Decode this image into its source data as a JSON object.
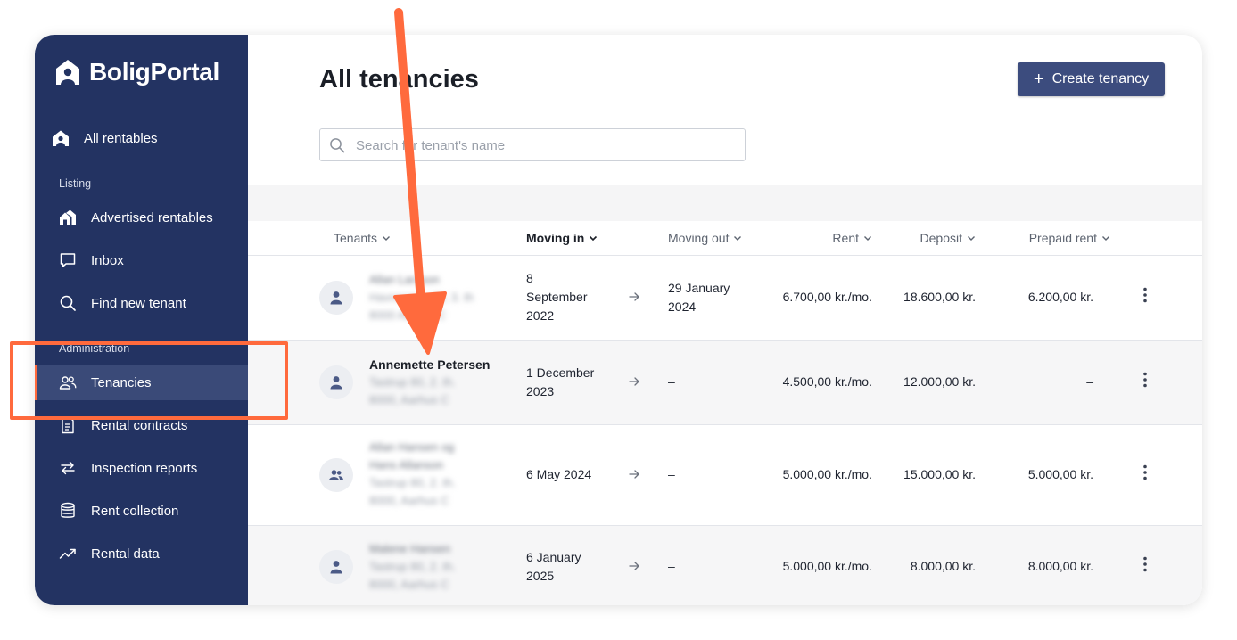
{
  "brand": {
    "name": "BoligPortal"
  },
  "sidebar": {
    "top_item": {
      "label": "All rentables"
    },
    "sections": [
      {
        "label": "Listing"
      },
      {
        "label": "Administration"
      }
    ],
    "items": [
      {
        "label": "Advertised rentables"
      },
      {
        "label": "Inbox"
      },
      {
        "label": "Find new tenant"
      },
      {
        "label": "Tenancies"
      },
      {
        "label": "Rental contracts"
      },
      {
        "label": "Inspection reports"
      },
      {
        "label": "Rent collection"
      },
      {
        "label": "Rental data"
      }
    ],
    "active_item": "Tenancies"
  },
  "main": {
    "title": "All tenancies",
    "create_button": {
      "label": "Create tenancy"
    },
    "search": {
      "placeholder": "Search for tenant's name",
      "value": ""
    },
    "table": {
      "columns": [
        "Tenants",
        "Moving in",
        "Moving out",
        "Rent",
        "Deposit",
        "Prepaid rent"
      ],
      "sorted_column": "Moving in",
      "rows": [
        {
          "tenant_lines": [
            "Allan Larsson",
            "Havnegade 38, 3. th",
            "8000 Aarhus C"
          ],
          "moving_in": [
            "8",
            "September",
            "2022"
          ],
          "moving_out": [
            "29 January",
            "2024"
          ],
          "rent": "6.700,00 kr./mo.",
          "deposit": "18.600,00 kr.",
          "prepaid_rent": "6.200,00 kr."
        },
        {
          "tenant_name": "Annemette Petersen",
          "tenant_lines": [
            "Tastrup 80, 2. th.",
            "8000, Aarhus C"
          ],
          "moving_in": [
            "1 December",
            "2023"
          ],
          "moving_out": [
            "–"
          ],
          "rent": "4.500,00 kr./mo.",
          "deposit": "12.000,00 kr.",
          "prepaid_rent": "–"
        },
        {
          "tenant_lines": [
            "Allan Hansen og",
            "Hans Allanson",
            "Tastrup 80, 2. th.",
            "8000, Aarhus C"
          ],
          "moving_in": [
            "6 May 2024"
          ],
          "moving_out": [
            "–"
          ],
          "rent": "5.000,00 kr./mo.",
          "deposit": "15.000,00 kr.",
          "prepaid_rent": "5.000,00 kr."
        },
        {
          "tenant_lines": [
            "Malene Hansen",
            "Tastrup 80, 2. th.",
            "8000, Aarhus C"
          ],
          "moving_in": [
            "6 January",
            "2025"
          ],
          "moving_out": [
            "–"
          ],
          "rent": "5.000,00 kr./mo.",
          "deposit": "8.000,00 kr.",
          "prepaid_rent": "8.000,00 kr."
        }
      ]
    }
  },
  "annotation": {
    "color": "#ff6a3d"
  }
}
